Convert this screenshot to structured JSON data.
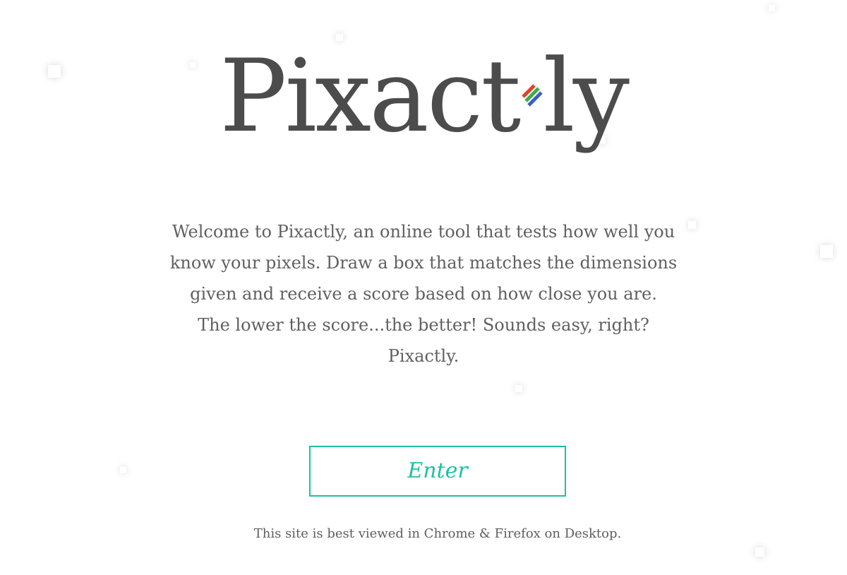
{
  "logo": {
    "text_before_mark": "Pixact",
    "text_after_mark": "ly",
    "text_color": "#4c4c4c",
    "mark_colors": [
      "#e2402b",
      "#3fae49",
      "#3a5fc4"
    ]
  },
  "intro": {
    "lines": [
      "Welcome to Pixactly, an online tool that tests how well you",
      "know your pixels. Draw a box that matches the dimensions",
      "given and receive a score based on how close you are.",
      "The lower the score...the better! Sounds easy, right?",
      "Pixactly."
    ]
  },
  "enter_button": {
    "label": "Enter",
    "accent_color": "#1ec0a3"
  },
  "footer": {
    "note": "This site is best viewed in Chrome & Firefox on Desktop."
  }
}
